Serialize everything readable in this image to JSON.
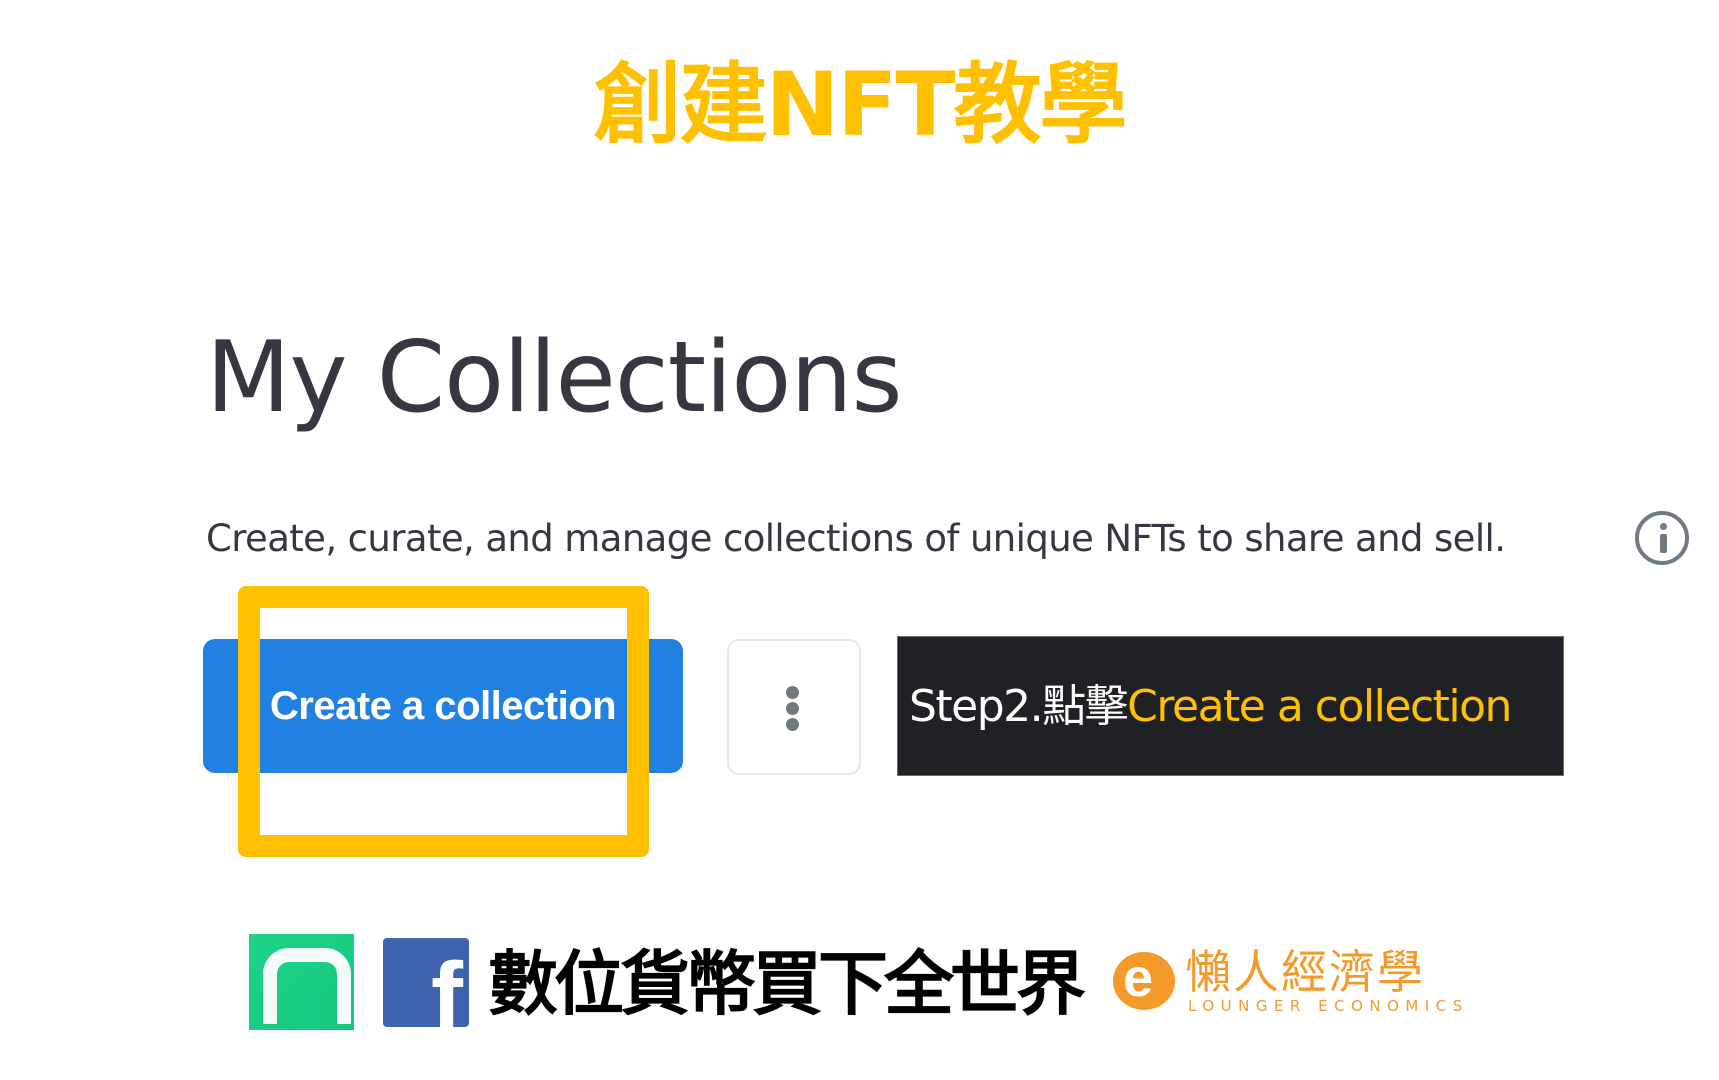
{
  "overlay": {
    "title": "創建NFT教學",
    "callout": {
      "prefix": "Step2.點擊",
      "highlight": "Create a collection"
    },
    "colors": {
      "accent": "#FFC000",
      "callout_bg": "#202125"
    }
  },
  "page": {
    "heading": "My Collections",
    "description": "Create, curate, and manage collections of unique NFTs to share and sell.",
    "info_icon": "info-circle-icon",
    "create_button_label": "Create a collection",
    "more_button_icon": "more-vertical-icon",
    "colors": {
      "primary_button": "#2081E2",
      "text": "#353840"
    }
  },
  "footer": {
    "app_icon": "app-logo-icon",
    "facebook_icon": "facebook-icon",
    "facebook_glyph": "f",
    "slogan": "數位貨幣買下全世界",
    "brand_logo_glyph": "e",
    "brand_name": "懶人經濟學",
    "brand_subtitle": "LOUNGER ECONOMICS"
  }
}
